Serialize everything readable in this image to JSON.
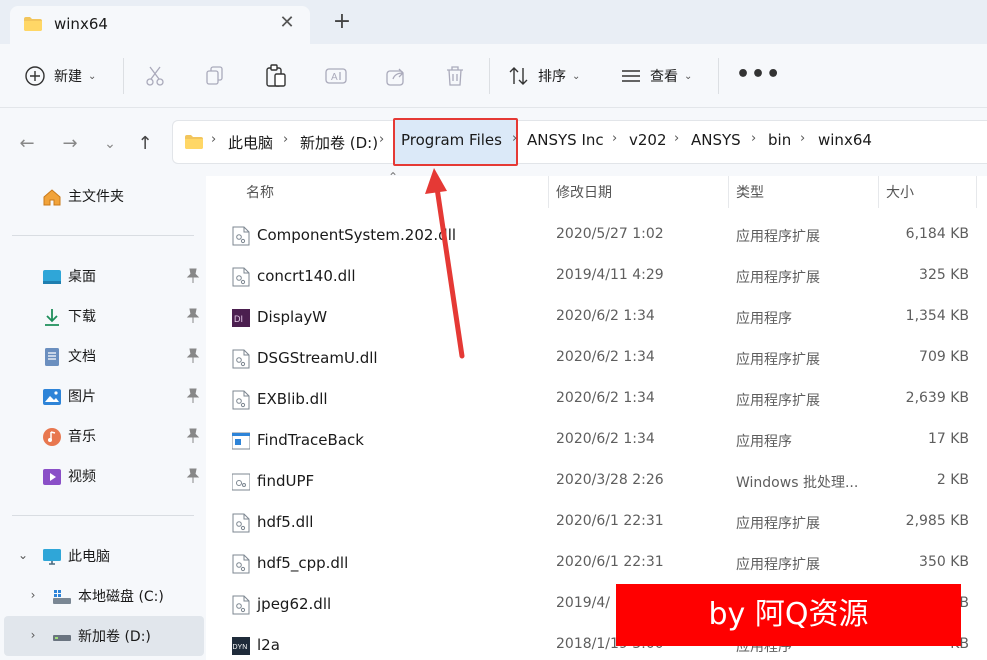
{
  "tab": {
    "title": "winx64",
    "close": "✕",
    "new_tab": "+"
  },
  "toolbar": {
    "new_label": "新建",
    "sort_label": "排序",
    "view_label": "查看",
    "more": "•••"
  },
  "address": {
    "crumbs": [
      "此电脑",
      "新加卷 (D:)",
      "Program Files",
      "ANSYS Inc",
      "v202",
      "ANSYS",
      "bin",
      "winx64"
    ]
  },
  "sidebar": {
    "home": "主文件夹",
    "quick": [
      "桌面",
      "下载",
      "文档",
      "图片",
      "音乐",
      "视频"
    ],
    "this_pc": "此电脑",
    "drives": [
      "本地磁盘 (C:)",
      "新加卷 (D:)"
    ]
  },
  "columns": {
    "name": "名称",
    "date": "修改日期",
    "type": "类型",
    "size": "大小"
  },
  "files": [
    {
      "name": "ComponentSystem.202.dll",
      "date": "2020/5/27 1:02",
      "type": "应用程序扩展",
      "size": "6,184 KB",
      "icon": "dll-icon"
    },
    {
      "name": "concrt140.dll",
      "date": "2019/4/11 4:29",
      "type": "应用程序扩展",
      "size": "325 KB",
      "icon": "dll-icon"
    },
    {
      "name": "DisplayW",
      "date": "2020/6/2 1:34",
      "type": "应用程序",
      "size": "1,354 KB",
      "icon": "di-app-icon"
    },
    {
      "name": "DSGStreamU.dll",
      "date": "2020/6/2 1:34",
      "type": "应用程序扩展",
      "size": "709 KB",
      "icon": "dll-icon"
    },
    {
      "name": "EXBlib.dll",
      "date": "2020/6/2 1:34",
      "type": "应用程序扩展",
      "size": "2,639 KB",
      "icon": "dll-icon"
    },
    {
      "name": "FindTraceBack",
      "date": "2020/6/2 1:34",
      "type": "应用程序",
      "size": "17 KB",
      "icon": "exe-icon"
    },
    {
      "name": "findUPF",
      "date": "2020/3/28 2:26",
      "type": "Windows 批处理...",
      "size": "2 KB",
      "icon": "batch-icon"
    },
    {
      "name": "hdf5.dll",
      "date": "2020/6/1 22:31",
      "type": "应用程序扩展",
      "size": "2,985 KB",
      "icon": "dll-icon"
    },
    {
      "name": "hdf5_cpp.dll",
      "date": "2020/6/1 22:31",
      "type": "应用程序扩展",
      "size": "350 KB",
      "icon": "dll-icon"
    },
    {
      "name": "jpeg62.dll",
      "date": "2019/4/",
      "type": "",
      "size": "B",
      "icon": "dll-icon"
    },
    {
      "name": "l2a",
      "date": "2018/1/19 3:00",
      "type": "应用程序",
      "size": "KB",
      "icon": "dyn-app-icon"
    }
  ],
  "watermark": "by 阿Q资源",
  "colors": {
    "highlight": "#e53935",
    "banner": "#ff0000",
    "accent": "#0067c0"
  }
}
